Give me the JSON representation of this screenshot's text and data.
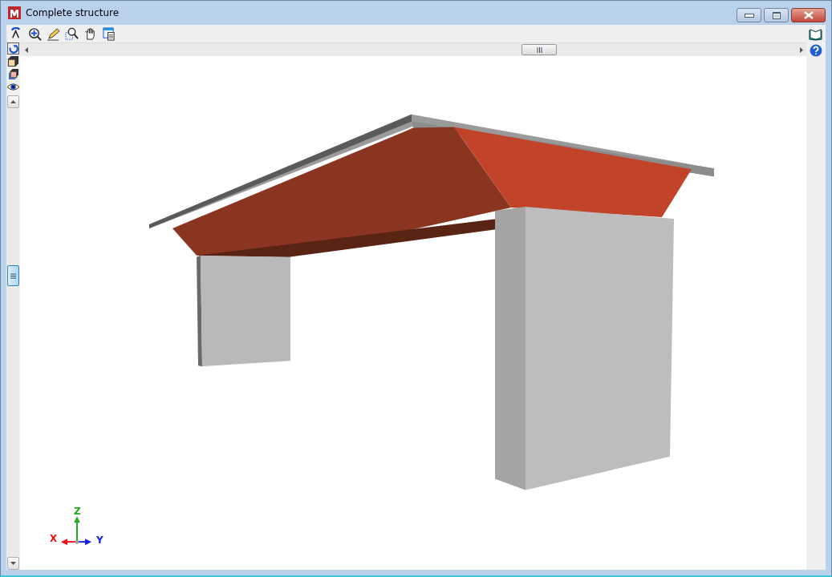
{
  "window": {
    "title": "Complete structure"
  },
  "axes": [
    {
      "label": "Z",
      "color": "#22aa22"
    },
    {
      "label": "X",
      "color": "#ee1111"
    },
    {
      "label": "Y",
      "color": "#1122dd"
    }
  ]
}
